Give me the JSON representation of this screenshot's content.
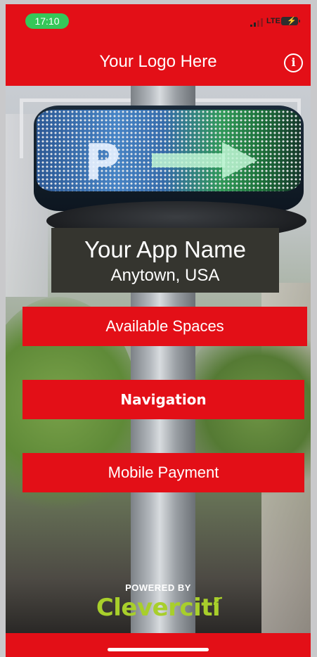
{
  "status_bar": {
    "time": "17:10",
    "network": "LTE",
    "time_pill_color": "#35c759"
  },
  "header": {
    "logo_text": "Your Logo Here",
    "info_icon": "info-circle-icon",
    "background": "#e30f17"
  },
  "hero": {
    "app_name": "Your App Name",
    "location": "Anytown, USA"
  },
  "menu": {
    "items": [
      {
        "label": "Available Spaces"
      },
      {
        "label": "Navigation"
      },
      {
        "label": "Mobile Payment"
      }
    ],
    "button_color": "#e30f17"
  },
  "footer": {
    "powered_by": "POWERED BY",
    "brand": "Cleverciti",
    "brand_color": "#a8cf2b"
  }
}
